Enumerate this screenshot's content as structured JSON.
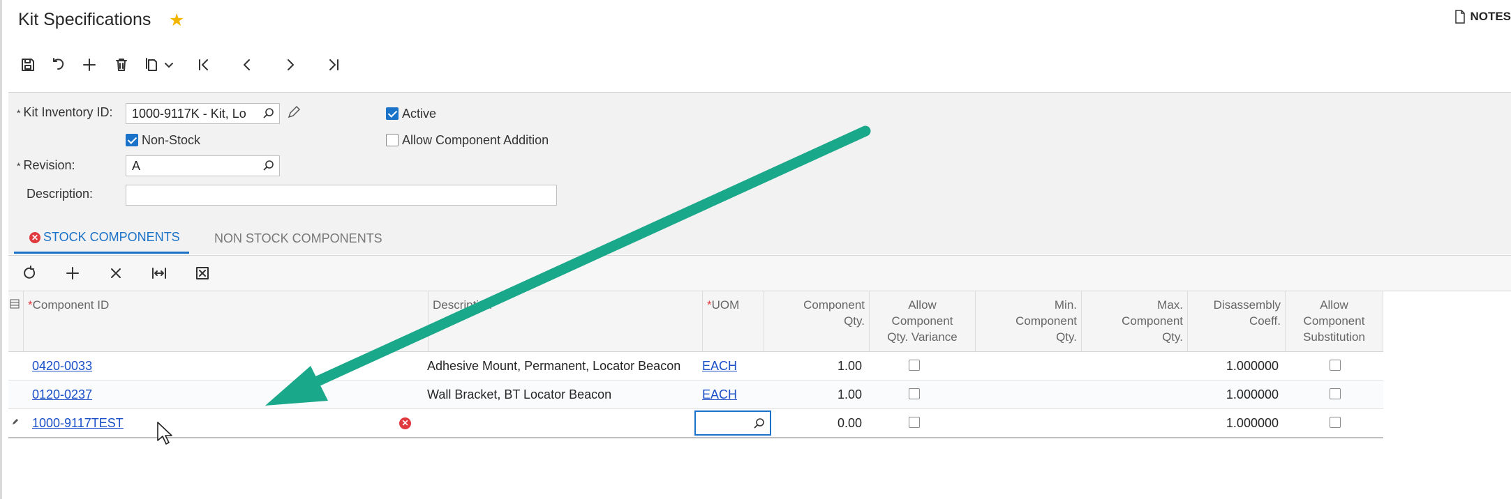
{
  "page": {
    "title": "Kit Specifications",
    "notes_label": "NOTES"
  },
  "toolbar": {
    "buttons": [
      "save-icon",
      "undo-icon",
      "add-icon",
      "delete-icon",
      "copy-paste-icon",
      "first-record-icon",
      "previous-icon",
      "next-icon",
      "last-record-icon"
    ]
  },
  "form": {
    "kit_inventory_id_label": "Kit Inventory ID:",
    "kit_inventory_id_value": "1000-9117K - Kit, Lo",
    "non_stock_label": "Non-Stock",
    "non_stock_checked": true,
    "revision_label": "Revision:",
    "revision_value": "A",
    "description_label": "Description:",
    "description_value": "",
    "active_label": "Active",
    "active_checked": true,
    "allow_component_addition_label": "Allow Component Addition",
    "allow_component_addition_checked": false,
    "required_mark": "*"
  },
  "tabs": [
    {
      "label": "STOCK COMPONENTS",
      "active": true,
      "has_error": true
    },
    {
      "label": "NON STOCK COMPONENTS",
      "active": false,
      "has_error": false
    }
  ],
  "grid": {
    "toolbar": [
      "refresh-icon",
      "add-row-icon",
      "delete-row-icon",
      "fit-columns-icon",
      "export-excel-icon"
    ],
    "columns": {
      "component_id": "Component ID",
      "description": "Description",
      "uom": "UOM",
      "component_qty_1": "Component",
      "component_qty_2": "Qty.",
      "allow_var_1": "Allow",
      "allow_var_2": "Component",
      "allow_var_3": "Qty. Variance",
      "min_qty_1": "Min.",
      "min_qty_2": "Component",
      "min_qty_3": "Qty.",
      "max_qty_1": "Max.",
      "max_qty_2": "Component",
      "max_qty_3": "Qty.",
      "disassembly_1": "Disassembly",
      "disassembly_2": "Coeff.",
      "allow_sub_1": "Allow",
      "allow_sub_2": "Component",
      "allow_sub_3": "Substitution"
    },
    "rows": [
      {
        "component_id": "0420-0033",
        "description": "Adhesive Mount, Permanent, Locator Beacon",
        "uom": "EACH",
        "component_qty": "1.00",
        "allow_variance": false,
        "min_qty": "",
        "max_qty": "",
        "disassembly_coeff": "1.000000",
        "allow_substitution": false
      },
      {
        "component_id": "0120-0237",
        "description": "Wall Bracket, BT Locator Beacon",
        "uom": "EACH",
        "component_qty": "1.00",
        "allow_variance": false,
        "min_qty": "",
        "max_qty": "",
        "disassembly_coeff": "1.000000",
        "allow_substitution": false
      },
      {
        "component_id": "1000-9117TEST",
        "description": "",
        "uom": "",
        "component_qty": "0.00",
        "allow_variance": false,
        "min_qty": "",
        "max_qty": "",
        "disassembly_coeff": "1.000000",
        "allow_substitution": false,
        "has_error": true,
        "editing": true
      }
    ]
  },
  "colors": {
    "accent": "#1a73c8",
    "error": "#e0393e",
    "annotation_arrow": "#1aa88a",
    "star": "#f2b600"
  }
}
